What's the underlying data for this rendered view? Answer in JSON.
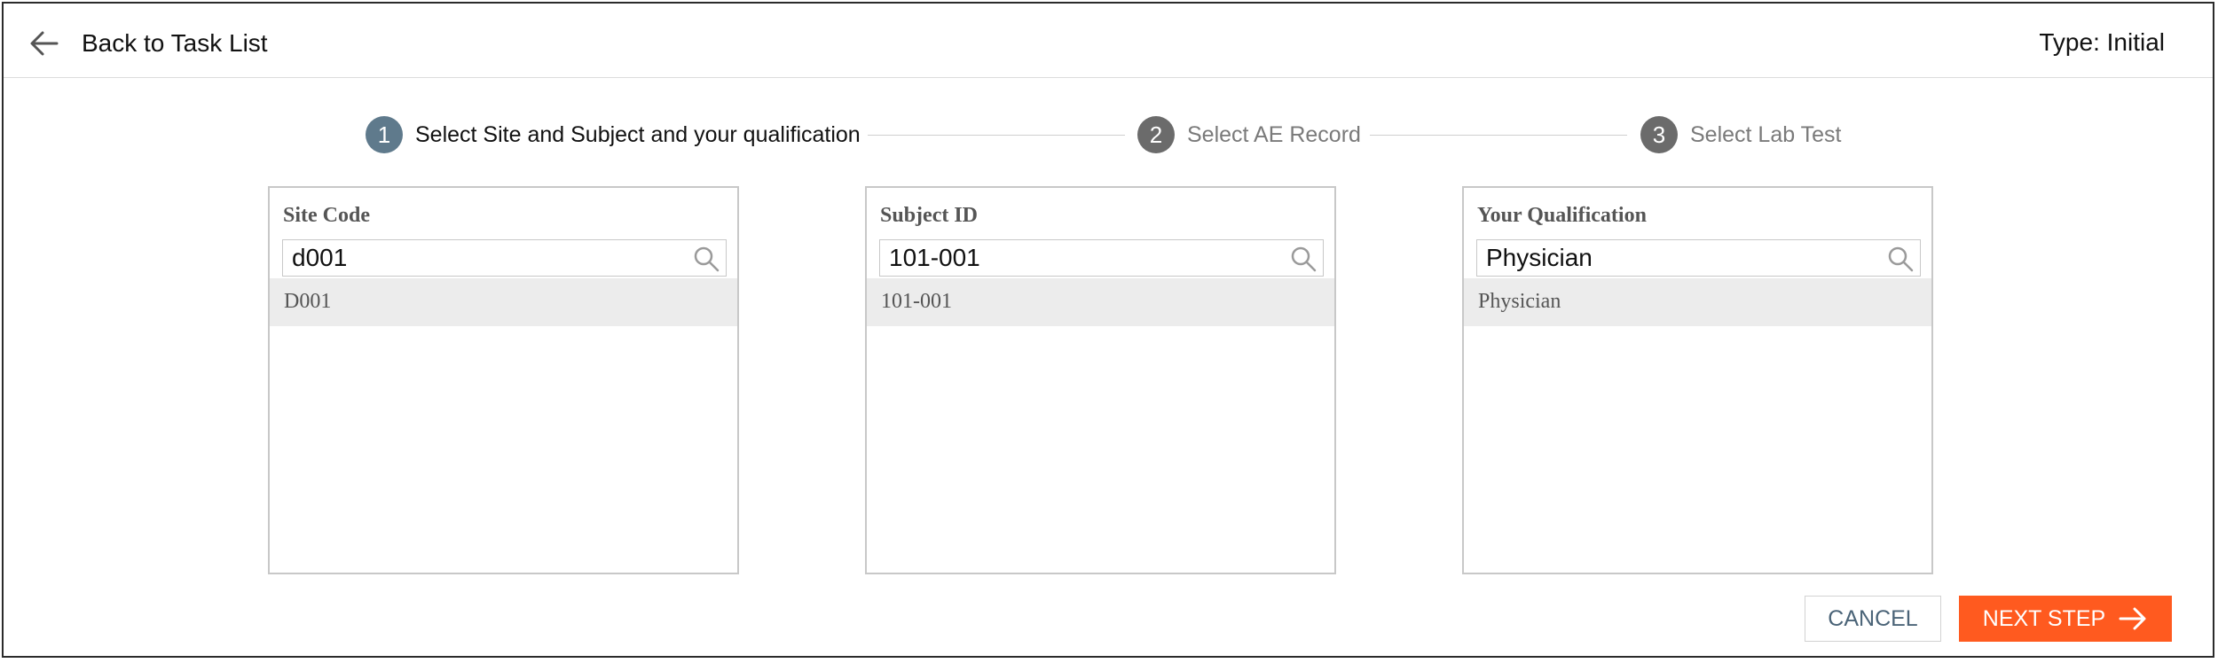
{
  "header": {
    "back_label": "Back to Task List",
    "type_label": "Type: Initial"
  },
  "stepper": {
    "steps": [
      {
        "number": "1",
        "label": "Select Site and Subject and your qualification",
        "state": "active"
      },
      {
        "number": "2",
        "label": "Select AE Record",
        "state": "inactive"
      },
      {
        "number": "3",
        "label": "Select Lab Test",
        "state": "inactive"
      }
    ]
  },
  "panels": [
    {
      "title": "Site Code",
      "search_value": "d001",
      "results": [
        "D001"
      ],
      "icon": "search-icon"
    },
    {
      "title": "Subject ID",
      "search_value": "101-001",
      "results": [
        "101-001"
      ],
      "icon": "search-icon"
    },
    {
      "title": "Your Qualification",
      "search_value": "Physician",
      "results": [
        "Physician"
      ],
      "icon": "search-icon"
    }
  ],
  "footer": {
    "cancel_label": "CANCEL",
    "next_label": "NEXT STEP"
  },
  "colors": {
    "accent": "#ff5a1f",
    "active_step": "#5f7a8c",
    "inactive_step": "#6b6b6b",
    "cancel_text": "#4b6478",
    "selected_row": "#ececec"
  }
}
